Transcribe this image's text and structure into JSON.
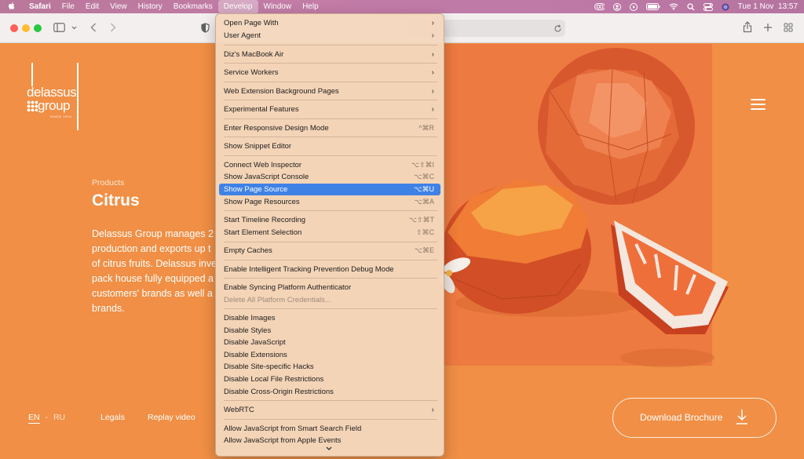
{
  "menubar": {
    "app": "Safari",
    "items": [
      "File",
      "Edit",
      "View",
      "History",
      "Bookmarks",
      "Develop",
      "Window",
      "Help"
    ],
    "active": "Develop",
    "clock": "Tue 1 Nov  13:57",
    "status_icons": [
      "cc-icon",
      "user-icon",
      "record-icon",
      "battery-icon",
      "wifi-icon",
      "search-icon",
      "control-center-icon",
      "siri-icon"
    ]
  },
  "toolbar": {
    "icons": [
      "sidebar-icon",
      "chevron-down-icon",
      "back-icon",
      "forward-icon",
      "shield-icon",
      "reload-icon",
      "share-icon",
      "new-tab-icon",
      "tab-overview-icon"
    ]
  },
  "page": {
    "logo": {
      "line1": "delassus",
      "line2": "group",
      "since": "SINCE 1919"
    },
    "products_label": "Products",
    "title": "Citrus",
    "description": "Delassus Group manages 2\nproduction and exports up t\nof citrus fruits. Delassus inve\npack house fully equipped a\ncustomers' brands as well a\nbrands.",
    "lang_en": "EN",
    "lang_sep": "-",
    "lang_ru": "RU",
    "legals": "Legals",
    "replay": "Replay video",
    "brochure": "Download Brochure"
  },
  "develop_menu": {
    "items": [
      {
        "label": "Open Page With",
        "arrow": true
      },
      {
        "label": "User Agent",
        "arrow": true
      },
      {
        "label": "Diz's MacBook Air",
        "arrow": true
      },
      {
        "label": "Service Workers",
        "arrow": true
      },
      {
        "label": "Web Extension Background Pages",
        "arrow": true
      },
      {
        "label": "Experimental Features",
        "arrow": true
      },
      {
        "label": "Enter Responsive Design Mode",
        "shortcut": "^⌘R"
      },
      {
        "label": "Show Snippet Editor"
      },
      {
        "label": "Connect Web Inspector",
        "shortcut": "⌥⇧⌘I"
      },
      {
        "label": "Show JavaScript Console",
        "shortcut": "⌥⌘C"
      },
      {
        "label": "Show Page Source",
        "shortcut": "⌥⌘U",
        "highlighted": true
      },
      {
        "label": "Show Page Resources",
        "shortcut": "⌥⌘A"
      },
      {
        "label": "Start Timeline Recording",
        "shortcut": "⌥⇧⌘T"
      },
      {
        "label": "Start Element Selection",
        "shortcut": "⇧⌘C"
      },
      {
        "label": "Empty Caches",
        "shortcut": "⌥⌘E"
      },
      {
        "label": "Enable Intelligent Tracking Prevention Debug Mode"
      },
      {
        "label": "Enable Syncing Platform Authenticator"
      },
      {
        "label": "Delete All Platform Credentials...",
        "disabled": true
      },
      {
        "label": "Disable Images"
      },
      {
        "label": "Disable Styles"
      },
      {
        "label": "Disable JavaScript"
      },
      {
        "label": "Disable Extensions"
      },
      {
        "label": "Disable Site-specific Hacks"
      },
      {
        "label": "Disable Local File Restrictions"
      },
      {
        "label": "Disable Cross-Origin Restrictions"
      },
      {
        "label": "WebRTC",
        "arrow": true
      },
      {
        "label": "Allow JavaScript from Smart Search Field"
      },
      {
        "label": "Allow JavaScript from Apple Events"
      }
    ],
    "scroll_more_icon": "chevron-down-icon"
  },
  "colors": {
    "page_bg": "#f08f45",
    "highlight": "#3f82e6",
    "menu_bg": "#f4d6bc"
  }
}
